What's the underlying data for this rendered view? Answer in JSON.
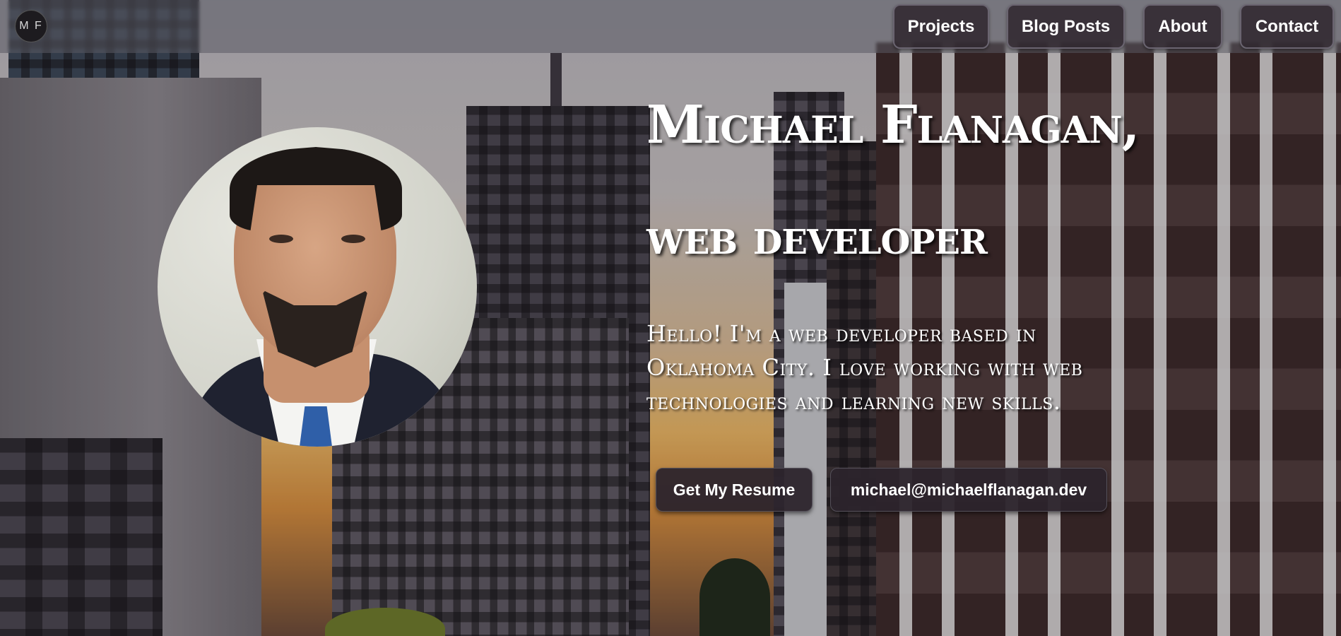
{
  "logo": {
    "initials": "M F"
  },
  "nav": {
    "projects": "Projects",
    "blog_posts": "Blog Posts",
    "about": "About",
    "contact": "Contact"
  },
  "hero": {
    "name_line": "Michael Flanagan,",
    "role_line": "web developer",
    "intro": "Hello! I'm a web developer based in Oklahoma City. I love working with web technologies and learning new skills.",
    "resume_button": "Get My Resume",
    "email_button": "michael@michaelflanagan.dev"
  },
  "colors": {
    "button_bg": "#2c242c",
    "text": "#ffffff"
  }
}
